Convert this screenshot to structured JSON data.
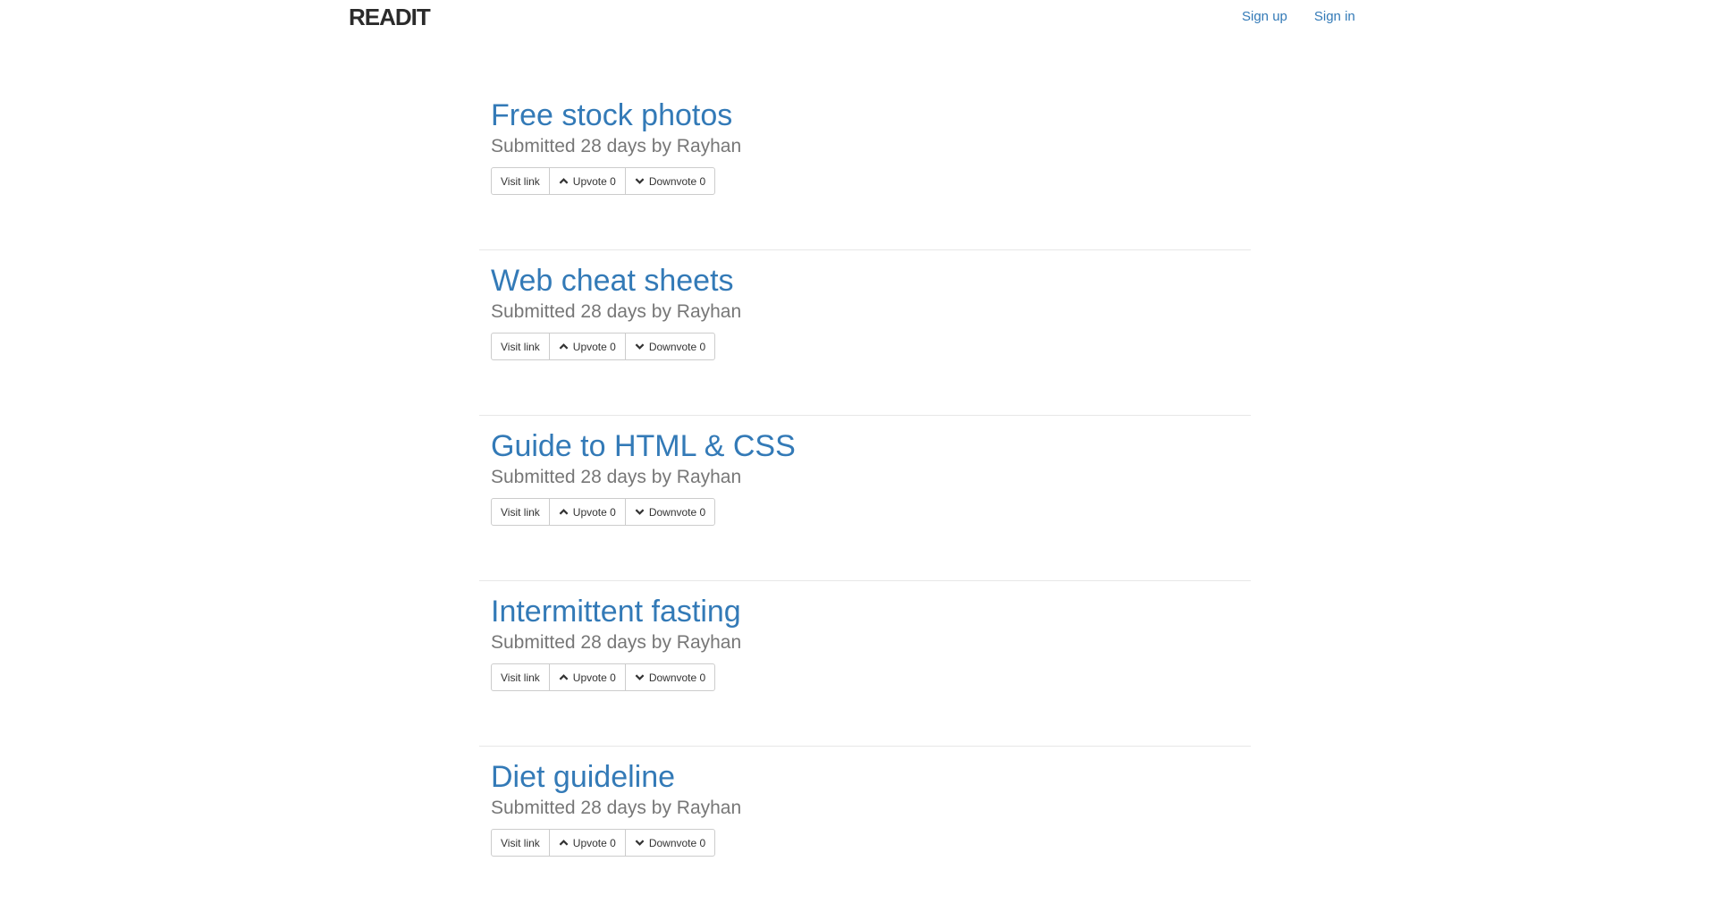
{
  "navbar": {
    "brand": "READIT",
    "signup_label": "Sign up",
    "signin_label": "Sign in"
  },
  "posts": [
    {
      "title": "Free stock photos",
      "meta": "Submitted 28 days by Rayhan",
      "visit_label": "Visit link",
      "upvote_label": "Upvote 0",
      "downvote_label": "Downvote 0"
    },
    {
      "title": "Web cheat sheets",
      "meta": "Submitted 28 days by Rayhan",
      "visit_label": "Visit link",
      "upvote_label": "Upvote 0",
      "downvote_label": "Downvote 0"
    },
    {
      "title": "Guide to HTML & CSS",
      "meta": "Submitted 28 days by Rayhan",
      "visit_label": "Visit link",
      "upvote_label": "Upvote 0",
      "downvote_label": "Downvote 0"
    },
    {
      "title": "Intermittent fasting",
      "meta": "Submitted 28 days by Rayhan",
      "visit_label": "Visit link",
      "upvote_label": "Upvote 0",
      "downvote_label": "Downvote 0"
    },
    {
      "title": "Diet guideline",
      "meta": "Submitted 28 days by Rayhan",
      "visit_label": "Visit link",
      "upvote_label": "Upvote 0",
      "downvote_label": "Downvote 0"
    }
  ],
  "icons": {
    "upvote": "chevron-up-icon",
    "downvote": "chevron-down-icon"
  },
  "colors": {
    "link": "#337ab7",
    "meta": "#777777",
    "border": "#cccccc"
  }
}
